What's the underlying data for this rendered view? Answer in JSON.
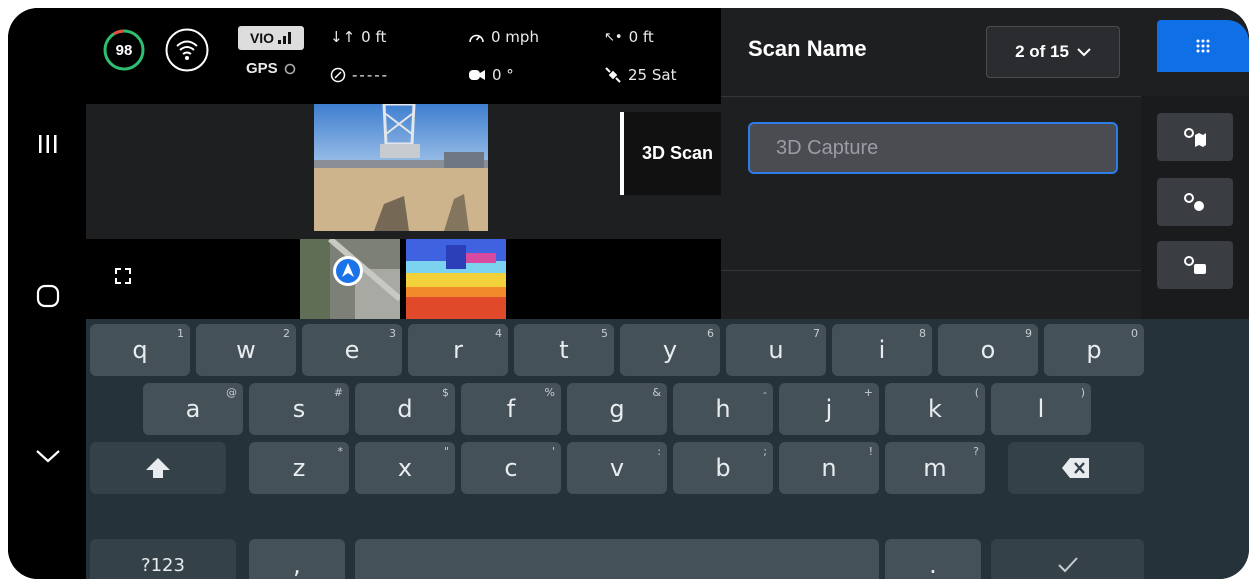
{
  "status": {
    "battery": "98",
    "vio": "VIO",
    "gps": "GPS",
    "altitude": "0 ft",
    "speed": "0 mph",
    "height": "0 ft",
    "heading": "-----",
    "gimbal": "0 °",
    "satellites": "25 Sat"
  },
  "feed": {
    "mode_label": "3D Scan"
  },
  "panel": {
    "title": "Scan Name",
    "select_value": "2 of 15",
    "input_placeholder": "3D Capture"
  },
  "colors": {
    "accent": "#0f6fe6",
    "battery_ring": "#2fbf71",
    "input_border": "#2c7de8"
  },
  "keyboard": {
    "row1": [
      {
        "k": "q",
        "h": "1"
      },
      {
        "k": "w",
        "h": "2"
      },
      {
        "k": "e",
        "h": "3"
      },
      {
        "k": "r",
        "h": "4"
      },
      {
        "k": "t",
        "h": "5"
      },
      {
        "k": "y",
        "h": "6"
      },
      {
        "k": "u",
        "h": "7"
      },
      {
        "k": "i",
        "h": "8"
      },
      {
        "k": "o",
        "h": "9"
      },
      {
        "k": "p",
        "h": "0"
      }
    ],
    "row2": [
      {
        "k": "a",
        "h": "@"
      },
      {
        "k": "s",
        "h": "#"
      },
      {
        "k": "d",
        "h": "$"
      },
      {
        "k": "f",
        "h": "%"
      },
      {
        "k": "g",
        "h": "&"
      },
      {
        "k": "h",
        "h": "-"
      },
      {
        "k": "j",
        "h": "+"
      },
      {
        "k": "k",
        "h": "("
      },
      {
        "k": "l",
        "h": ")"
      }
    ],
    "row3": [
      {
        "k": "z",
        "h": "*"
      },
      {
        "k": "x",
        "h": "\""
      },
      {
        "k": "c",
        "h": "'"
      },
      {
        "k": "v",
        "h": ":"
      },
      {
        "k": "b",
        "h": ";"
      },
      {
        "k": "n",
        "h": "!"
      },
      {
        "k": "m",
        "h": "?"
      }
    ],
    "sym": "?123",
    "comma": ",",
    "period": "."
  }
}
